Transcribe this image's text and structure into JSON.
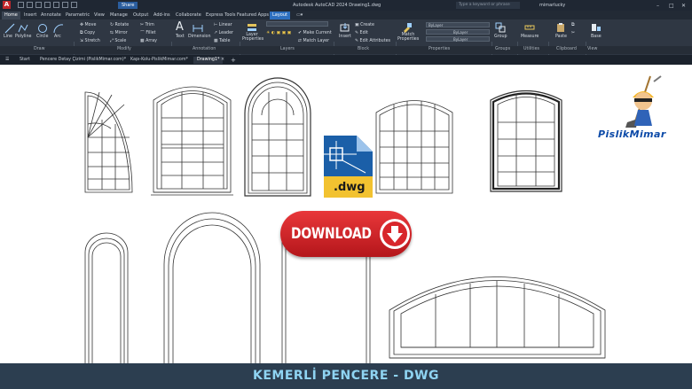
{
  "app": {
    "title": "Autodesk AutoCAD 2024   Drawing1.dwg",
    "logo_letter": "A",
    "share_label": "Share",
    "search_placeholder": "Type a keyword or phrase",
    "user_name": "mimarlucky"
  },
  "ribbon_tabs": [
    {
      "label": "Home",
      "active": true
    },
    {
      "label": "Insert"
    },
    {
      "label": "Annotate"
    },
    {
      "label": "Parametric"
    },
    {
      "label": "View"
    },
    {
      "label": "Manage"
    },
    {
      "label": "Output"
    },
    {
      "label": "Add-ins"
    },
    {
      "label": "Collaborate"
    },
    {
      "label": "Express Tools"
    },
    {
      "label": "Featured Apps"
    },
    {
      "label": "Layout"
    }
  ],
  "ribbon": {
    "draw": {
      "line": "Line",
      "polyline": "Polyline",
      "circle": "Circle",
      "arc": "Arc"
    },
    "modify": {
      "move": "Move",
      "rotate": "Rotate",
      "trim": "Trim",
      "copy": "Copy",
      "mirror": "Mirror",
      "fillet": "Fillet",
      "stretch": "Stretch",
      "scale": "Scale",
      "array": "Array"
    },
    "annotation": {
      "text": "Text",
      "dimension": "Dimension",
      "linear": "Linear",
      "leader": "Leader",
      "table": "Table"
    },
    "layers": {
      "layer_properties": "Layer Properties",
      "make_current": "Make Current",
      "match_layer": "Match Layer"
    },
    "block": {
      "insert": "Insert",
      "create": "Create",
      "edit": "Edit",
      "edit_attributes": "Edit Attributes"
    },
    "properties": {
      "match_properties": "Match Properties",
      "bylayer_1": "ByLayer",
      "bylayer_2": "ByLayer",
      "bylayer_3": "ByLayer"
    },
    "groups": {
      "group": "Group"
    },
    "utilities": {
      "measure": "Measure"
    },
    "clipboard": {
      "paste": "Paste"
    },
    "view": {
      "base": "Base"
    }
  },
  "panels": [
    "Draw",
    "Modify",
    "Annotation",
    "Layers",
    "Block",
    "Properties",
    "Groups",
    "Utilities",
    "Clipboard",
    "View"
  ],
  "doc_tabs": [
    {
      "label": "Start"
    },
    {
      "label": "Pencere Detay Çizimi (PislikMimar.com)*"
    },
    {
      "label": "Kapı-Kolu-PislikMimar.com*"
    },
    {
      "label": "Drawing1*",
      "active": true
    }
  ],
  "overlay": {
    "download_label": "DOWNLOAD",
    "dwg_label": ".dwg",
    "brand": "PislikMimar",
    "footer_title": "KEMERLİ PENCERE - DWG"
  },
  "colors": {
    "titlebar": "#1f2733",
    "ribbon": "#2f3743",
    "download_red": "#d8262b",
    "footer_bg": "#2c3e50",
    "footer_text": "#8fd4f2",
    "brand_blue": "#0c4aa8"
  }
}
